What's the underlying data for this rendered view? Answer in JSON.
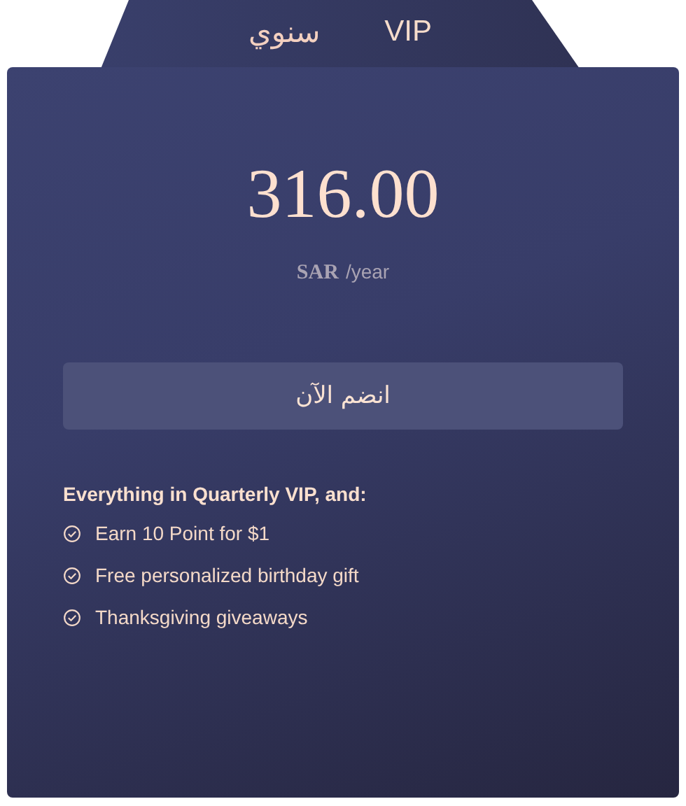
{
  "header": {
    "period": "سنوي",
    "plan": "VIP"
  },
  "price": {
    "amount": "316.00",
    "currency": "SAR",
    "unit": "/year"
  },
  "join_button": {
    "label": "انضم الآن"
  },
  "features": {
    "heading": "Everything in Quarterly VIP, and:",
    "items": [
      "Earn 10 Point for $1",
      "Free personalized birthday gift",
      "Thanksgiving giveaways"
    ]
  }
}
